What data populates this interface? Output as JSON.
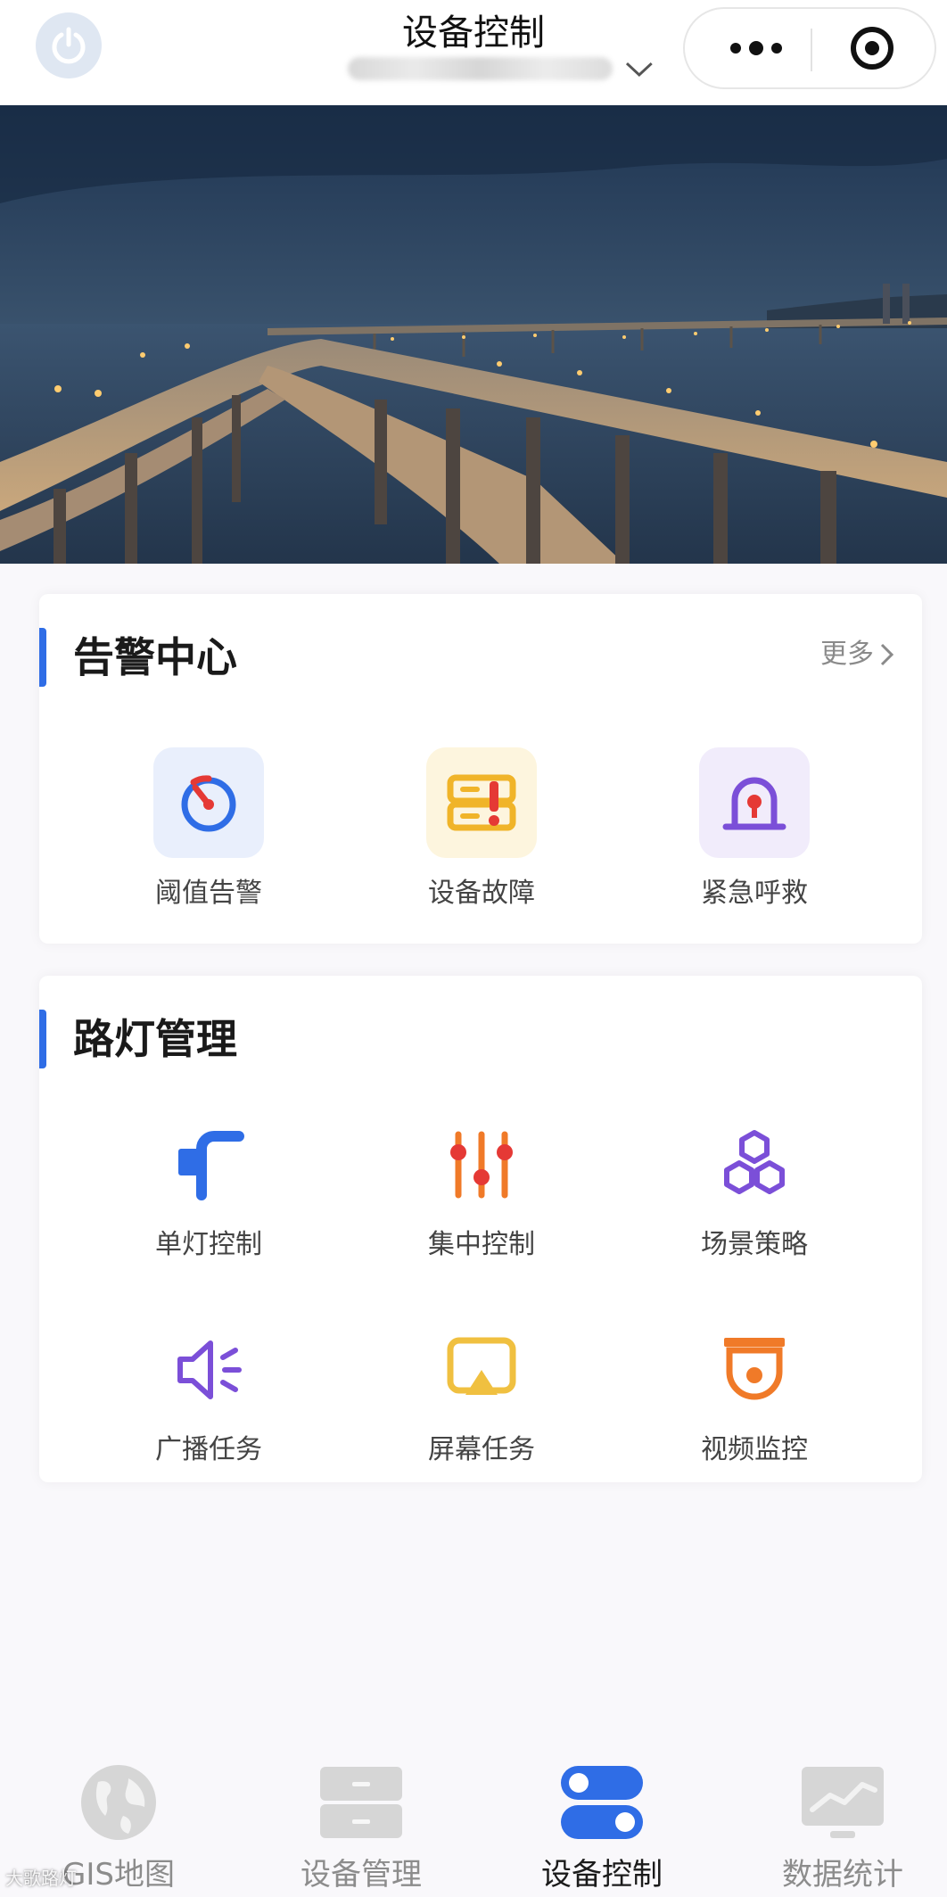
{
  "header": {
    "title": "设备控制",
    "location_dropdown": {
      "value": ""
    }
  },
  "alarm_center": {
    "title": "告警中心",
    "more_label": "更多",
    "items": [
      {
        "label": "阈值告警",
        "icon": "stopwatch-icon",
        "color": "#2f6de6",
        "bg": "#e9effc"
      },
      {
        "label": "设备故障",
        "icon": "server-fault-icon",
        "color": "#f0b429",
        "bg": "#fdf5de"
      },
      {
        "label": "紧急呼救",
        "icon": "emergency-siren-icon",
        "color": "#7b4fd8",
        "bg": "#f1ecfb"
      }
    ]
  },
  "streetlight_mgmt": {
    "title": "路灯管理",
    "items": [
      {
        "label": "单灯控制",
        "icon": "street-lamp-icon",
        "color": "#2f6de6"
      },
      {
        "label": "集中控制",
        "icon": "sliders-icon",
        "color": "#f07a28"
      },
      {
        "label": "场景策略",
        "icon": "hexagons-icon",
        "color": "#7b4fd8"
      },
      {
        "label": "广播任务",
        "icon": "speaker-icon",
        "color": "#7b4fd8"
      },
      {
        "label": "屏幕任务",
        "icon": "screen-cast-icon",
        "color": "#f0c040"
      },
      {
        "label": "视频监控",
        "icon": "camera-icon",
        "color": "#f07a28"
      }
    ]
  },
  "bottom_nav": {
    "active_index": 2,
    "items": [
      {
        "label": "GIS地图",
        "icon": "globe-icon"
      },
      {
        "label": "设备管理",
        "icon": "device-drawer-icon"
      },
      {
        "label": "设备控制",
        "icon": "toggle-switches-icon"
      },
      {
        "label": "数据统计",
        "icon": "line-chart-icon"
      }
    ]
  },
  "watermark": "大歌路灯"
}
